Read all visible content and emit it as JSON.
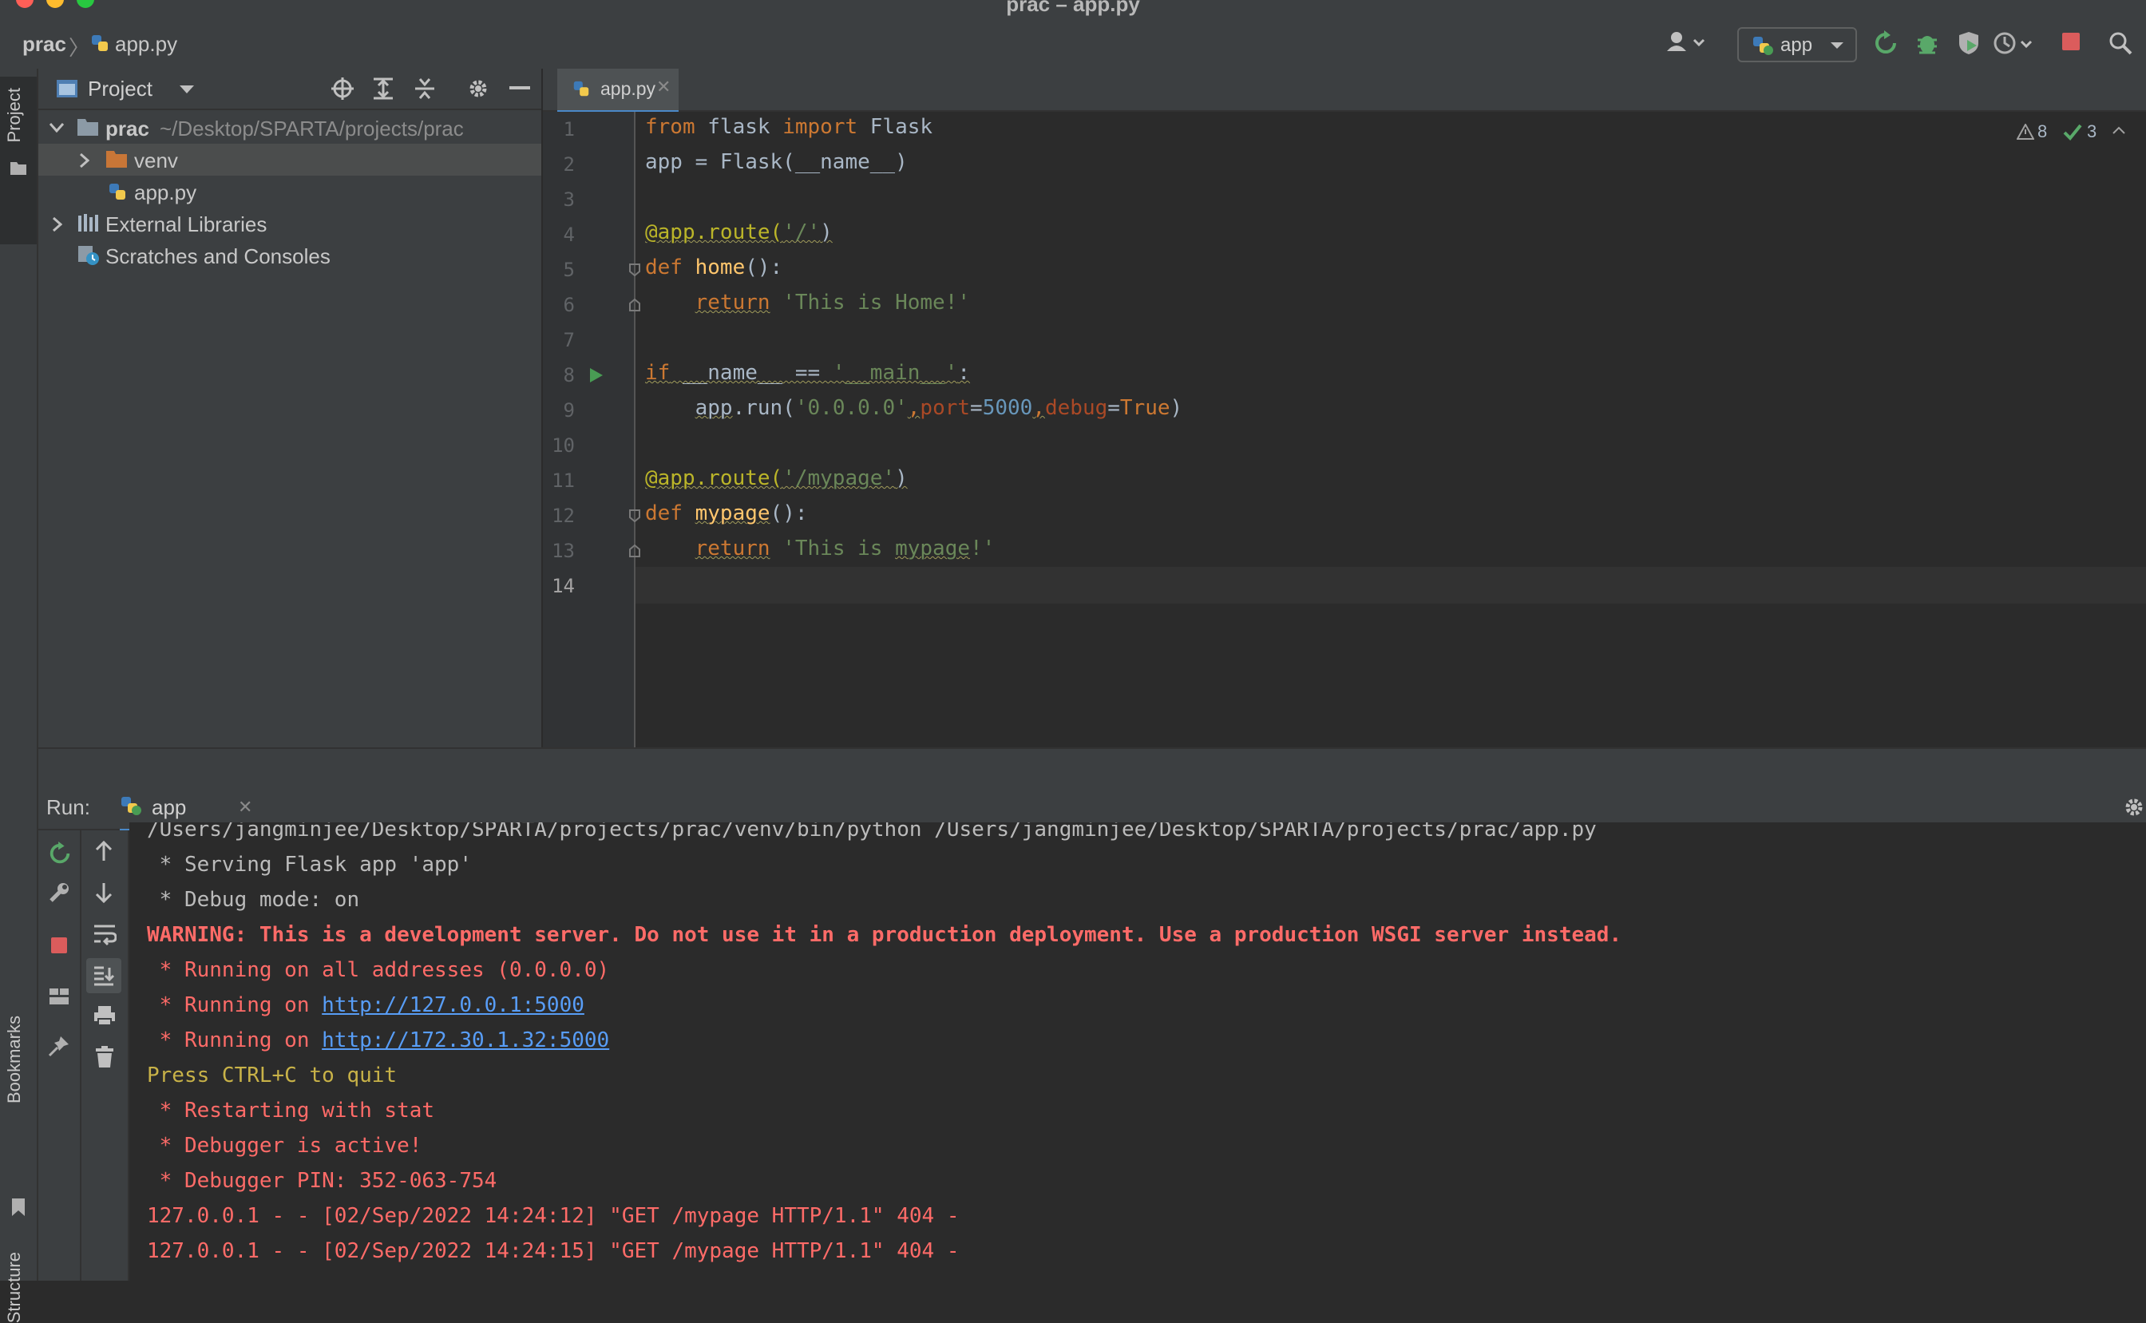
{
  "window": {
    "title": "prac – app.py"
  },
  "breadcrumb": {
    "project": "prac",
    "file": "app.py"
  },
  "toolbar": {
    "run_config": "app"
  },
  "sidebar": {
    "project_tab": "Project",
    "bookmarks_tab": "Bookmarks",
    "structure_tab": "Structure"
  },
  "project_panel": {
    "title": "Project",
    "tree": [
      {
        "name": "prac",
        "path": "~/Desktop/SPARTA/projects/prac"
      },
      {
        "name": "venv"
      },
      {
        "name": "app.py"
      },
      {
        "name": "External Libraries"
      },
      {
        "name": "Scratches and Consoles"
      }
    ]
  },
  "editor": {
    "tab": "app.py",
    "warnings_count": "8",
    "ok_count": "3",
    "line_numbers": [
      "1",
      "2",
      "3",
      "4",
      "5",
      "6",
      "7",
      "8",
      "9",
      "10",
      "11",
      "12",
      "13",
      "14"
    ]
  },
  "run": {
    "label": "Run:",
    "tab": "app",
    "console": {
      "cmd": "/Users/jangminjee/Desktop/SPARTA/projects/prac/venv/bin/python /Users/jangminjee/Desktop/SPARTA/projects/prac/app.py",
      "l1": " * Serving Flask app 'app'",
      "l2": " * Debug mode: on",
      "warning": "WARNING: This is a development server. Do not use it in a production deployment. Use a production WSGI server instead.",
      "l4": " * Running on all addresses (0.0.0.0)",
      "l5_prefix": " * Running on ",
      "l5_link": "http://127.0.0.1:5000",
      "l6_prefix": " * Running on ",
      "l6_link": "http://172.30.1.32:5000",
      "quit": "Press CTRL+C to quit",
      "l8": " * Restarting with stat",
      "l9": " * Debugger is active!",
      "l10": " * Debugger PIN: 352-063-754",
      "log1": "127.0.0.1 - - [02/Sep/2022 14:24:12] \"GET /mypage HTTP/1.1\" 404 -",
      "log2": "127.0.0.1 - - [02/Sep/2022 14:24:15] \"GET /mypage HTTP/1.1\" 404 -"
    }
  },
  "colors": {
    "accent": "#4a88c7",
    "error": "#ff6b68",
    "keyword": "#cc7832",
    "string": "#6a8759",
    "number": "#6897bb",
    "decorator": "#bbb529"
  }
}
